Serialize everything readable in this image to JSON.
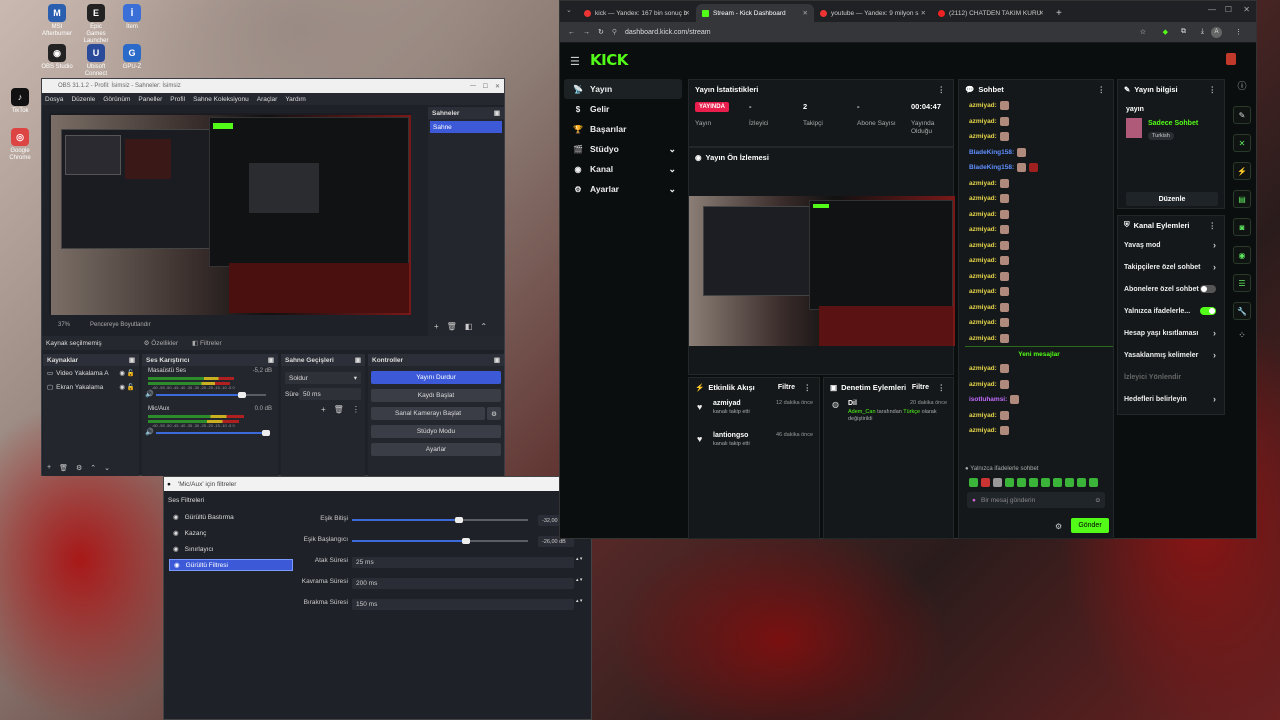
{
  "desktop": {
    "icons": [
      {
        "label": "MSI Afterburner",
        "color": "#2a5fb0",
        "glyph": "M"
      },
      {
        "label": "Epic Games Launcher",
        "color": "#222",
        "glyph": "E"
      },
      {
        "label": "İtem",
        "color": "#3b6fd8",
        "glyph": "İ"
      },
      {
        "label": "OBS Studio",
        "color": "#222",
        "glyph": "◉"
      },
      {
        "label": "Ubisoft Connect",
        "color": "#2a4a9a",
        "glyph": "U"
      },
      {
        "label": "GPU-Z",
        "color": "#2a6ac8",
        "glyph": "G"
      },
      {
        "label": "TikTok",
        "color": "#111",
        "glyph": "♪"
      },
      {
        "label": "Google Chrome",
        "color": "#d44",
        "glyph": "◎"
      }
    ]
  },
  "obs": {
    "title": "OBS 31.1.2 - Profil: İsimsiz - Sahneler: İsimsiz",
    "menu": [
      "Dosya",
      "Düzenle",
      "Görünüm",
      "Paneller",
      "Profil",
      "Sahne Koleksiyonu",
      "Araçlar",
      "Yardım"
    ],
    "preview": {
      "zoom": "37%",
      "fit_label": "Pencereye Boyutlandır"
    },
    "scenes": {
      "header": "Sahneler",
      "items": [
        "Sahne"
      ]
    },
    "source_bar": {
      "no_source": "Kaynak seçilmemiş",
      "properties": "Özellikler",
      "filters": "Filtreler"
    },
    "sources": {
      "header": "Kaynaklar",
      "items": [
        "Video Yakalama A",
        "Ekran Yakalama"
      ]
    },
    "mixer": {
      "header": "Ses Karıştırıcı",
      "channels": [
        {
          "name": "Masaüstü Ses",
          "db": "-5,2 dB",
          "level": 0.72
        },
        {
          "name": "Mic/Aux",
          "db": "0.0 dB",
          "level": 0.8
        }
      ],
      "scale": "-60 -55 -50 -45 -40 -35 -30 -25 -20 -15 -10 -5 0"
    },
    "transitions": {
      "header": "Sahne Geçişleri",
      "type": "Soldur",
      "duration_label": "Süre",
      "duration": "50 ms"
    },
    "controls": {
      "header": "Kontroller",
      "stop_stream": "Yayını Durdur",
      "start_record": "Kaydı Başlat",
      "virtual_cam": "Sanal Kamerayı Başlat",
      "studio_mode": "Stüdyo Modu",
      "settings": "Ayarlar"
    }
  },
  "filter_dialog": {
    "title": "'Mic/Aux' için filtreler",
    "section": "Ses Filtreleri",
    "filters": [
      "Gürültü Bastırma",
      "Kazanç",
      "Sınırlayıcı",
      "Gürültü Filtresi"
    ],
    "selected": "Gürültü Filtresi",
    "params": [
      {
        "label": "Eşik Bitişi",
        "value": "-32,00 dB",
        "fill": 0.78
      },
      {
        "label": "Eşik Başlangıcı",
        "value": "-26,00 dB",
        "fill": 0.83
      },
      {
        "label": "Atak Süresi",
        "value": "25 ms"
      },
      {
        "label": "Kavrama Süresi",
        "value": "200 ms"
      },
      {
        "label": "Bırakma Süresi",
        "value": "150 ms"
      }
    ]
  },
  "browser": {
    "tabs": [
      {
        "label": "kick — Yandex: 167 bin sonuç b",
        "color": "#e33"
      },
      {
        "label": "Stream - Kick Dashboard",
        "color": "#53fc18"
      },
      {
        "label": "youtube — Yandex: 9 milyon s",
        "color": "#e33"
      },
      {
        "label": "(2112) CHATDEN TAKIM KURU",
        "color": "#e22"
      }
    ],
    "url": "dashboard.kick.com/stream"
  },
  "kick": {
    "logo": "KICK",
    "nav": [
      {
        "label": "Yayın",
        "active": true
      },
      {
        "label": "Gelir"
      },
      {
        "label": "Başarılar"
      },
      {
        "label": "Stüdyo",
        "expand": true
      },
      {
        "label": "Kanal",
        "expand": true
      },
      {
        "label": "Ayarlar",
        "expand": true
      }
    ],
    "stats": {
      "header": "Yayın İstatistikleri",
      "live_badge": "YAYINDA",
      "items": [
        {
          "value": "",
          "label": "Yayın"
        },
        {
          "value": "-",
          "label": "İzleyici"
        },
        {
          "value": "2",
          "label": "Takipçi"
        },
        {
          "value": "-",
          "label": "Abone Sayısı"
        },
        {
          "value": "00:04:47",
          "label": "Yayında Olduğu"
        }
      ]
    },
    "preview_header": "Yayın Ön İzlemesi",
    "activity": {
      "header": "Etkinlik Akışı",
      "filter": "Filtre",
      "items": [
        {
          "name": "azmiyad",
          "action": "kanalı takip etti",
          "time": "12 dakika önce"
        },
        {
          "name": "lantiongso",
          "action": "kanalı takip etti",
          "time": "46 dakika önce"
        }
      ]
    },
    "moderation": {
      "header": "Denetim Eylemleri",
      "filter": "Filtre",
      "items": [
        {
          "title": "Dil",
          "user": "Adem_Can",
          "mid": "tarafından",
          "lang": "Türkçe",
          "rest": "olarak değiştirildi",
          "time": "20 dakika önce"
        }
      ]
    },
    "chat": {
      "header": "Sohbet",
      "messages": [
        {
          "user": "azmiyad:",
          "color": "#e6d44a",
          "emotes": 1
        },
        {
          "user": "azmiyad:",
          "color": "#e6d44a",
          "emotes": 1
        },
        {
          "user": "azmiyad:",
          "color": "#e6d44a",
          "emotes": 1
        },
        {
          "user": "BladeKing158:",
          "color": "#5f8fff",
          "emotes": 1
        },
        {
          "user": "BladeKing158:",
          "color": "#5f8fff",
          "emotes": 2
        },
        {
          "user": "azmiyad:",
          "color": "#e6d44a",
          "emotes": 1
        },
        {
          "user": "azmiyad:",
          "color": "#e6d44a",
          "emotes": 1
        },
        {
          "user": "azmiyad:",
          "color": "#e6d44a",
          "emotes": 1
        },
        {
          "user": "azmiyad:",
          "color": "#e6d44a",
          "emotes": 1
        },
        {
          "user": "azmiyad:",
          "color": "#e6d44a",
          "emotes": 1
        },
        {
          "user": "azmiyad:",
          "color": "#e6d44a",
          "emotes": 1
        },
        {
          "user": "azmiyad:",
          "color": "#e6d44a",
          "emotes": 1
        },
        {
          "user": "azmiyad:",
          "color": "#e6d44a",
          "emotes": 1
        },
        {
          "user": "azmiyad:",
          "color": "#e6d44a",
          "emotes": 1
        },
        {
          "user": "azmiyad:",
          "color": "#e6d44a",
          "emotes": 1
        },
        {
          "user": "azmiyad:",
          "color": "#e6d44a",
          "emotes": 1
        }
      ],
      "new_label": "Yeni mesajlar",
      "new_messages": [
        {
          "user": "azmiyad:",
          "color": "#e6d44a"
        },
        {
          "user": "azmiyad:",
          "color": "#e6d44a"
        },
        {
          "user": "isotluhamsi:",
          "color": "#c36cff"
        },
        {
          "user": "azmiyad:",
          "color": "#e6d44a"
        },
        {
          "user": "azmiyad:",
          "color": "#e6d44a"
        }
      ],
      "mode_note": "Yalnızca ifadelerle sohbet",
      "placeholder": "Bir mesaj gönderin",
      "send": "Gönder"
    },
    "stream_info": {
      "header": "Yayın bilgisi",
      "title": "yayın",
      "category": "Sadece Sohbet",
      "tag": "Turkish",
      "edit": "Düzenle"
    },
    "channel_actions": {
      "header": "Kanal Eylemleri",
      "items": [
        {
          "label": "Yavaş mod",
          "kind": "chev"
        },
        {
          "label": "Takipçilere özel sohbet",
          "kind": "chev"
        },
        {
          "label": "Abonelere özel sohbet",
          "kind": "toggle",
          "on": false
        },
        {
          "label": "Yalnızca ifadelerle...",
          "kind": "toggle",
          "on": true
        },
        {
          "label": "Hesap yaşı kısıtlaması",
          "kind": "chev"
        },
        {
          "label": "Yasaklanmış kelimeler",
          "kind": "chev"
        },
        {
          "label": "İzleyici Yönlendir",
          "kind": "dim"
        },
        {
          "label": "Hedefleri belirleyin",
          "kind": "chev"
        }
      ]
    }
  },
  "colors": {
    "kick_green": "#53fc18",
    "obs_blue": "#3c5ad8",
    "live_red": "#e91e4c"
  }
}
